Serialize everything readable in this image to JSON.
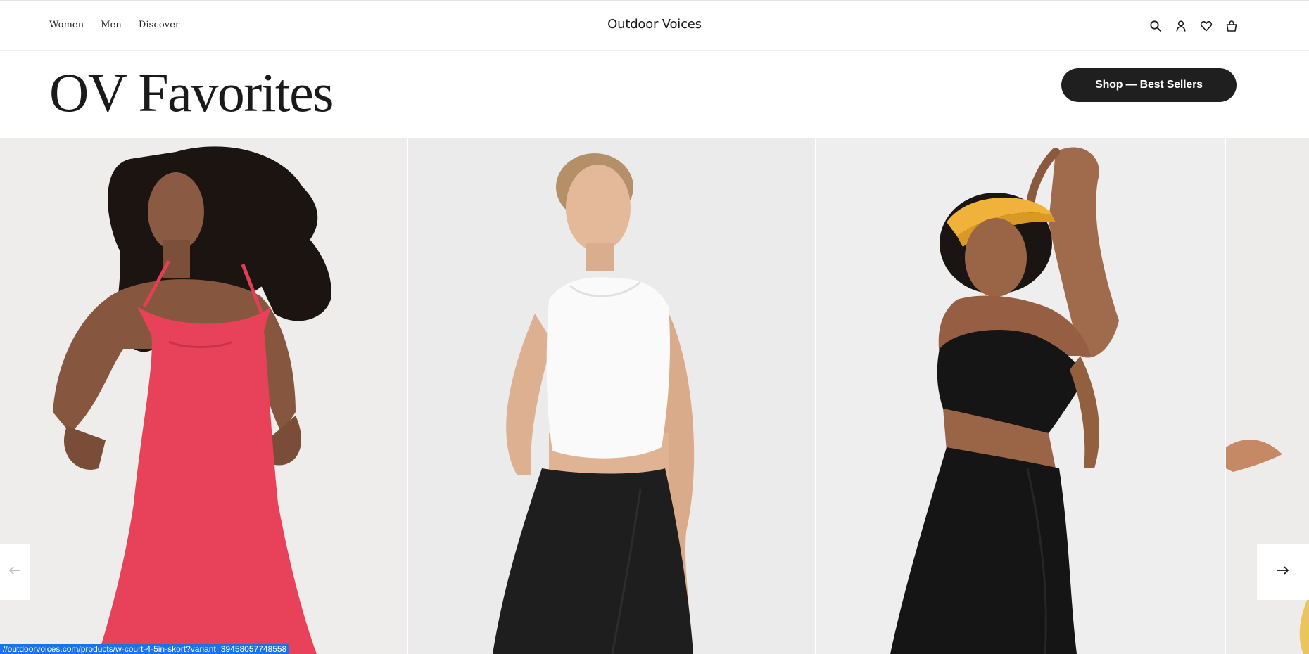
{
  "nav": {
    "items": [
      {
        "label": "Women"
      },
      {
        "label": "Men"
      },
      {
        "label": "Discover"
      }
    ]
  },
  "brand": "Outdoor Voices",
  "header_icons": [
    "search-icon",
    "account-icon",
    "heart-icon",
    "bag-icon"
  ],
  "section": {
    "title": "OV Favorites",
    "cta_label": "Shop — Best Sellers"
  },
  "carousel": {
    "products": [
      {
        "name": "red exercise dress",
        "product_color": "#e8425a"
      },
      {
        "name": "white crop top with black skort",
        "product_color": "#1e1e1e"
      },
      {
        "name": "black sports bra with black skort and yellow visor",
        "product_color": "#151515"
      },
      {
        "name": "partial product card"
      }
    ],
    "prev_icon": "arrow-left-icon",
    "next_icon": "arrow-right-icon"
  },
  "status_bar": {
    "url": "//outdoorvoices.com/products/w-court-4-5in-skort?variant=39458057748558"
  },
  "colors": {
    "cta_bg": "#1f1f1f",
    "status_bg": "#1a73e8"
  }
}
